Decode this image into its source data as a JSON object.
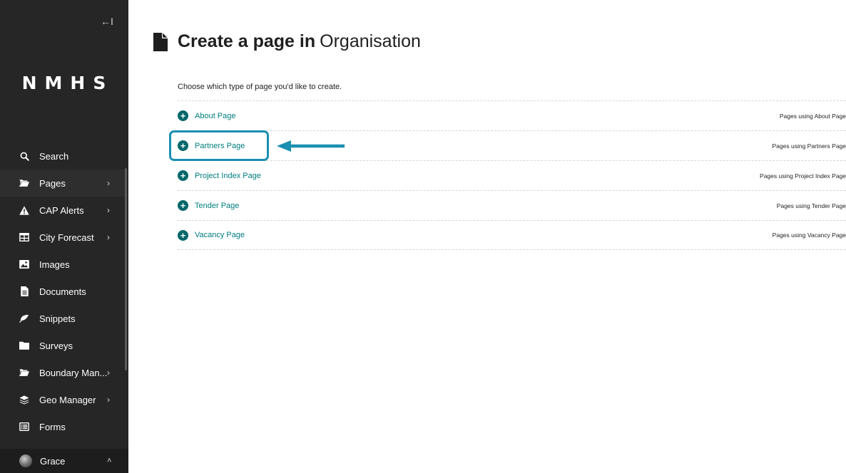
{
  "sidebar": {
    "collapse_label": "←I",
    "logo": "NMHS",
    "items": [
      {
        "label": "Search",
        "icon": "search-icon",
        "has_submenu": false
      },
      {
        "label": "Pages",
        "icon": "folder-open-icon",
        "has_submenu": true
      },
      {
        "label": "CAP Alerts",
        "icon": "warning-icon",
        "has_submenu": true
      },
      {
        "label": "City Forecast",
        "icon": "table-icon",
        "has_submenu": true
      },
      {
        "label": "Images",
        "icon": "image-icon",
        "has_submenu": false
      },
      {
        "label": "Documents",
        "icon": "document-icon",
        "has_submenu": false
      },
      {
        "label": "Snippets",
        "icon": "leaf-icon",
        "has_submenu": false
      },
      {
        "label": "Surveys",
        "icon": "folder-icon",
        "has_submenu": false
      },
      {
        "label": "Boundary Man...",
        "icon": "folder-open-icon",
        "has_submenu": true
      },
      {
        "label": "Geo Manager",
        "icon": "layers-icon",
        "has_submenu": true
      },
      {
        "label": "Forms",
        "icon": "list-icon",
        "has_submenu": false
      }
    ],
    "user": {
      "name": "Grace"
    }
  },
  "header": {
    "title_strong": "Create a page in",
    "title_light": "Organisation",
    "icon": "document-icon"
  },
  "main": {
    "intro": "Choose which type of page you'd like to create.",
    "page_types": [
      {
        "label": "About Page",
        "usage": "Pages using About Page"
      },
      {
        "label": "Partners Page",
        "usage": "Pages using Partners Page"
      },
      {
        "label": "Project Index Page",
        "usage": "Pages using Project Index Page"
      },
      {
        "label": "Tender Page",
        "usage": "Pages using Tender Page"
      },
      {
        "label": "Vacancy Page",
        "usage": "Pages using Vacancy Page"
      }
    ]
  },
  "colors": {
    "sidebar_bg": "#262626",
    "accent_teal": "#00676a",
    "link_teal": "#007d7e",
    "highlight_blue": "#1b8fb2"
  }
}
